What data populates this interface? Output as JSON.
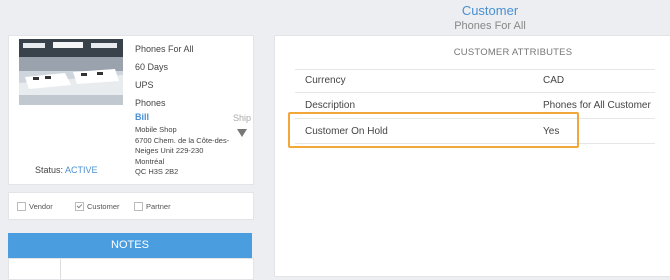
{
  "header": {
    "title": "Customer",
    "subtitle": "Phones For All"
  },
  "profile": {
    "company_name": "Phones For All",
    "terms": "60 Days",
    "carrier": "UPS",
    "category": "Phones",
    "bill_label": "Bill",
    "address_lines": [
      "Mobile Shop",
      "6700 Chem. de la Côte-des-",
      "Neiges Unit 229-230",
      "Montréal",
      "QC H3S 2B2"
    ],
    "ship_label": "Ship",
    "status_label": "Status:",
    "status_value": "ACTIVE"
  },
  "types": [
    {
      "label": "Vendor",
      "checked": false
    },
    {
      "label": "Customer",
      "checked": true
    },
    {
      "label": "Partner",
      "checked": false
    }
  ],
  "notes": {
    "title": "NOTES"
  },
  "attributes": {
    "title": "CUSTOMER ATTRIBUTES",
    "rows": [
      {
        "label": "Currency",
        "value": "CAD"
      },
      {
        "label": "Description",
        "value": "Phones for All Customer"
      },
      {
        "label": "Customer On Hold",
        "value": "Yes"
      }
    ]
  },
  "colors": {
    "accent": "#4a90d2",
    "notes_header": "#4a9ee0",
    "highlight": "#f2a73a"
  }
}
